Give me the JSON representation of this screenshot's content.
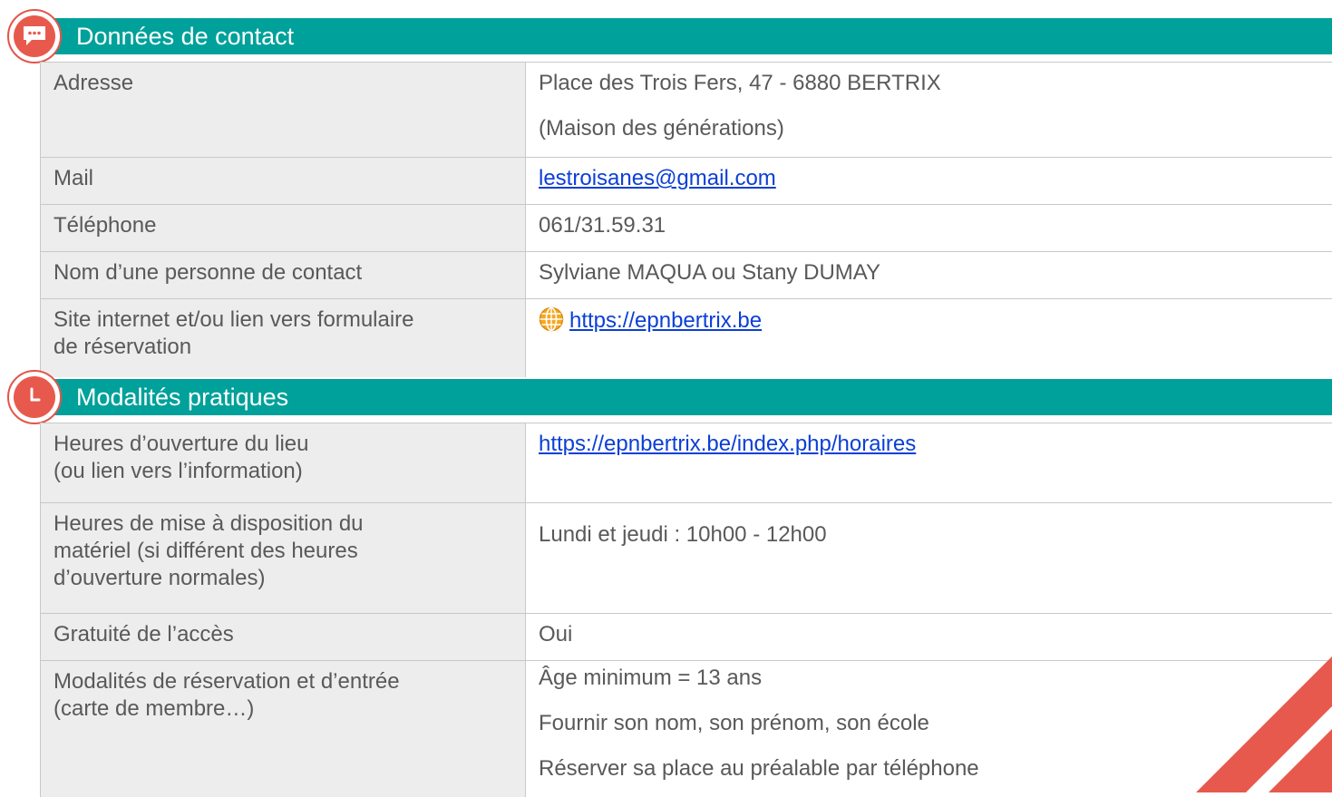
{
  "sections": [
    {
      "title": "Données de contact",
      "icon": "chat-bubble-icon",
      "rows": [
        {
          "label": [
            "Adresse"
          ],
          "values": [
            "Place des Trois Fers, 47 - 6880  BERTRIX",
            "(Maison des générations)"
          ]
        },
        {
          "label": [
            "Mail"
          ],
          "link": "lestroisanes@gmail.com"
        },
        {
          "label": [
            "Téléphone"
          ],
          "values": [
            "061/31.59.31"
          ]
        },
        {
          "label": [
            "Nom d’une personne de contact"
          ],
          "values": [
            "Sylviane MAQUA ou Stany DUMAY"
          ]
        },
        {
          "label": [
            "Site internet et/ou lien vers formulaire",
            "de réservation"
          ],
          "link": "https://epnbertrix.be",
          "link_icon": "globe-icon"
        }
      ]
    },
    {
      "title": "Modalités pratiques",
      "icon": "clock-icon",
      "rows": [
        {
          "label": [
            "Heures d’ouverture du lieu",
            "(ou lien vers l’information)"
          ],
          "link": "https://epnbertrix.be/index.php/horaires"
        },
        {
          "label": [
            "Heures de mise à disposition du",
            "matériel (si différent des heures",
            "d’ouverture normales)"
          ],
          "values": [
            "Lundi et jeudi : 10h00 - 12h00"
          ]
        },
        {
          "label": [
            "Gratuité de l’accès"
          ],
          "values": [
            "Oui"
          ]
        },
        {
          "label": [
            "Modalités de réservation et d’entrée",
            "(carte de membre…)"
          ],
          "values": [
            "Âge minimum = 13 ans",
            "Fournir son nom, son prénom, son école",
            "Réserver sa place au préalable par téléphone"
          ]
        }
      ]
    }
  ],
  "colors": {
    "header": "#00a19a",
    "accent": "#e8594d",
    "label_bg": "#ededed",
    "link": "#0b3fd6"
  },
  "decoration": "diagonal-stripes"
}
